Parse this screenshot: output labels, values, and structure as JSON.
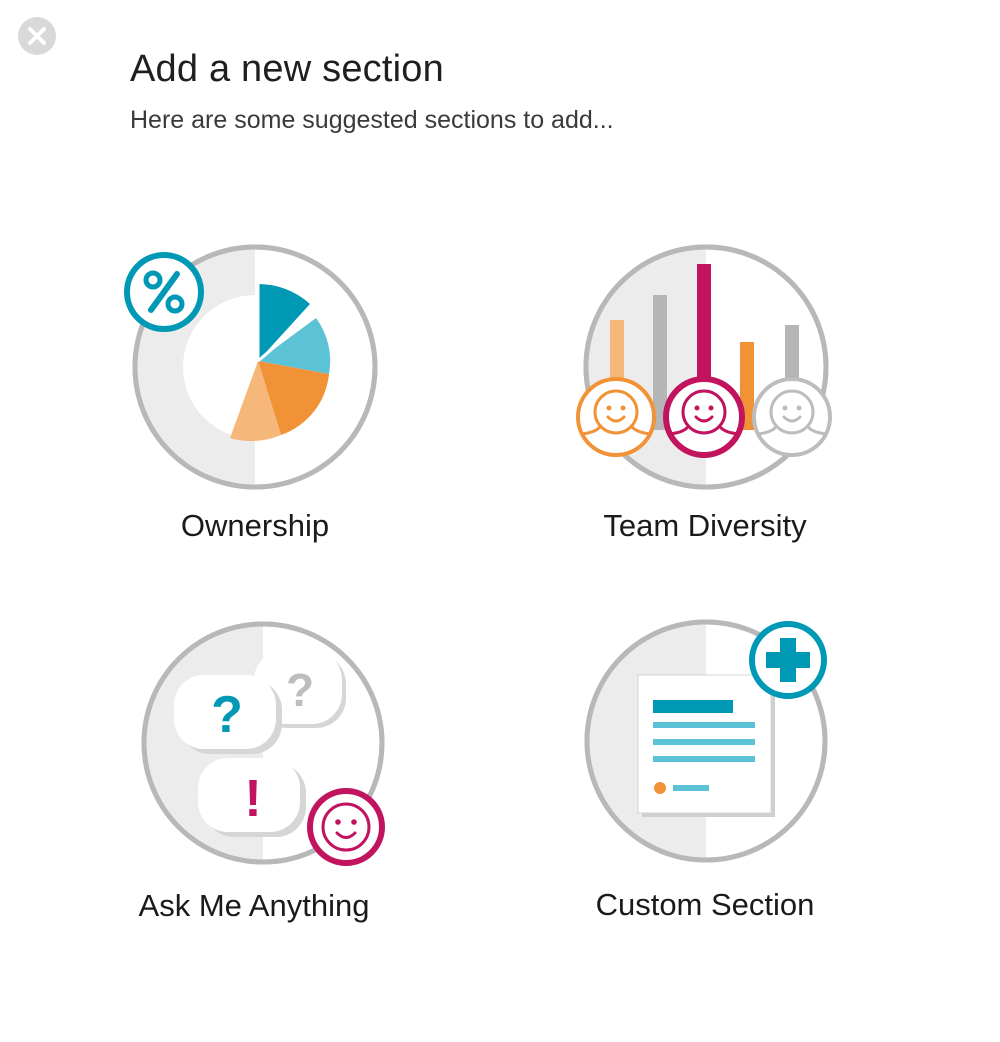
{
  "dialog": {
    "title": "Add a new section",
    "subtitle": "Here are some suggested sections to add..."
  },
  "close_button": {
    "icon": "close-icon"
  },
  "sections": [
    {
      "label": "Ownership",
      "icon": "pie-chart-icon",
      "badge_icon": "percent-icon"
    },
    {
      "label": "Team Diversity",
      "icon": "bar-chart-people-icon"
    },
    {
      "label": "Ask Me Anything",
      "icon": "question-bubbles-icon",
      "badge_icon": "smiley-icon"
    },
    {
      "label": "Custom Section",
      "icon": "document-icon",
      "badge_icon": "plus-icon"
    }
  ],
  "colors": {
    "teal": "#0099b5",
    "light_teal": "#5cc3d6",
    "orange": "#f29237",
    "light_orange": "#f5b77a",
    "magenta": "#c2135f",
    "gray": "#b5b5b5",
    "light_gray": "#ebebeb"
  }
}
